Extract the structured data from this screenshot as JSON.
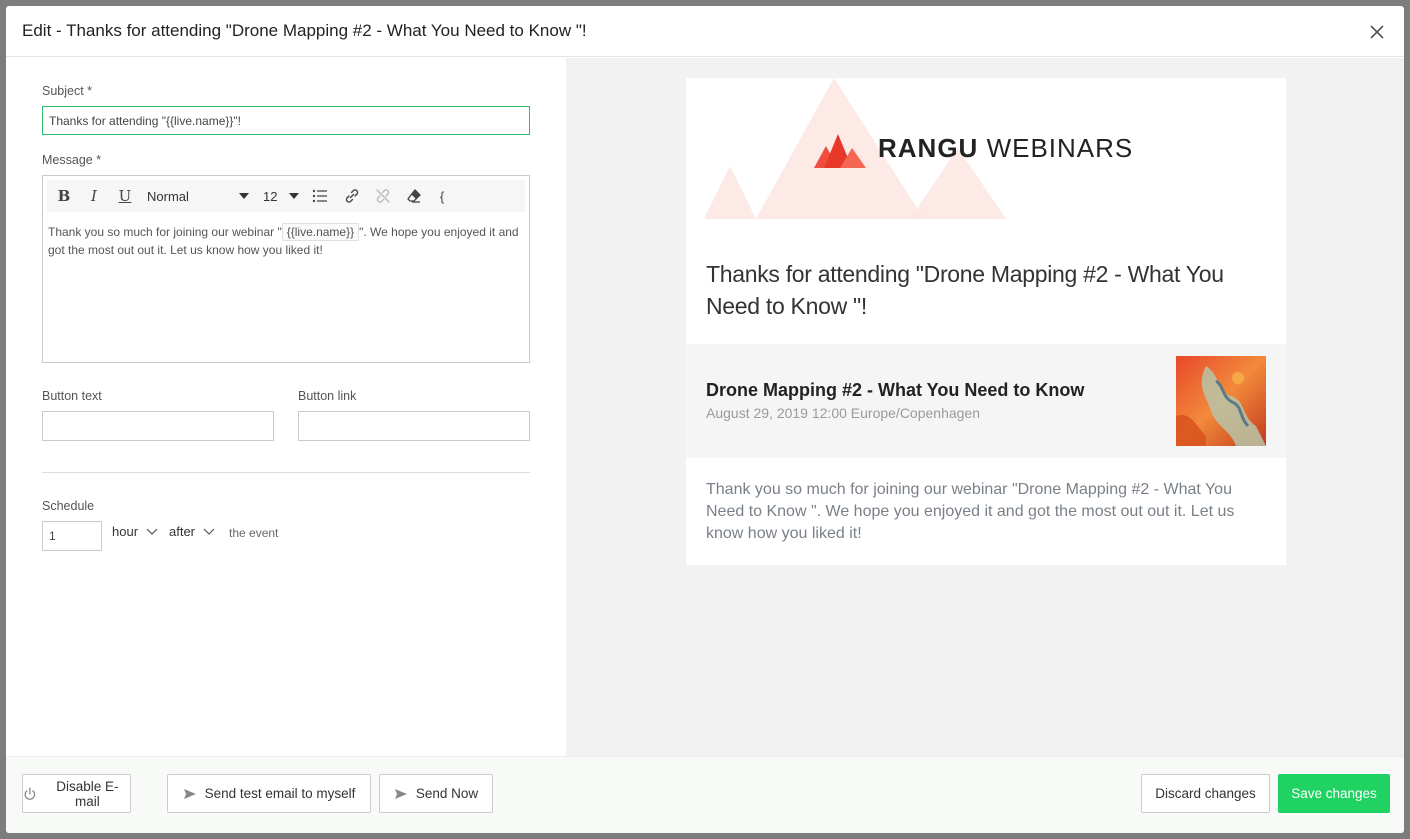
{
  "modal": {
    "title": "Edit - Thanks for attending \"Drone Mapping #2 - What You Need to Know \"!",
    "close_icon": "close-icon"
  },
  "form": {
    "subject_label": "Subject *",
    "subject_value": "Thanks for attending \"{{live.name}}\"!",
    "message_label": "Message *",
    "toolbar": {
      "bold": "B",
      "italic": "I",
      "underline": "U",
      "style_select": "Normal",
      "size_select": "12",
      "brace": "{"
    },
    "message": {
      "before_tag": "Thank you so much for joining our webinar \"",
      "tag": "{{live.name}}",
      "after_tag": "\". We hope you enjoyed it and got the most out out it. Let us know how you liked it!"
    },
    "button_text_label": "Button text",
    "button_text_value": "",
    "button_link_label": "Button link",
    "button_link_value": "",
    "schedule_label": "Schedule",
    "schedule_amount": "1",
    "schedule_unit": "hour",
    "schedule_relation": "after",
    "schedule_suffix": "the event"
  },
  "preview": {
    "logo_bold": "RANGU",
    "logo_light": "WEBINARS",
    "heading": "Thanks for attending \"Drone Mapping #2 - What You Need to Know \"!",
    "event_title": "Drone Mapping #2 - What You Need to Know",
    "event_date": "August 29, 2019 12:00 Europe/Copenhagen",
    "body": "Thank you so much for joining our webinar \"Drone Mapping #2 - What You Need to Know \". We hope you enjoyed it and got the most out out it. Let us know how you liked it!",
    "accent_color": "#f04e3e"
  },
  "footer": {
    "disable_email": "Disable E-mail",
    "send_test": "Send test email to myself",
    "send_now": "Send Now",
    "discard": "Discard changes",
    "save": "Save changes",
    "save_color": "#1fd262"
  }
}
